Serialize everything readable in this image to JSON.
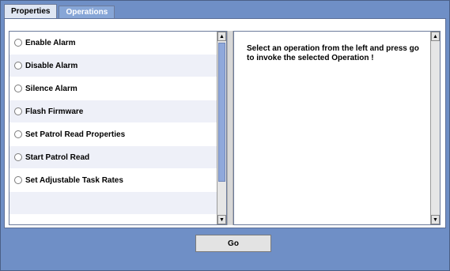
{
  "tabs": [
    {
      "label": "Properties",
      "active": true
    },
    {
      "label": "Operations",
      "active": false
    }
  ],
  "operations": [
    {
      "label": "Enable Alarm",
      "selected": false
    },
    {
      "label": "Disable Alarm",
      "selected": false
    },
    {
      "label": "Silence Alarm",
      "selected": false
    },
    {
      "label": "Flash Firmware",
      "selected": false
    },
    {
      "label": "Set Patrol Read Properties",
      "selected": false
    },
    {
      "label": "Start Patrol Read",
      "selected": false
    },
    {
      "label": "Set Adjustable Task Rates",
      "selected": false
    }
  ],
  "instructions": "Select an operation from the left and press go to invoke the selected Operation !",
  "go_button": "Go",
  "colors": {
    "frame": "#6f8fc6",
    "tab_active": "#dfe6f3",
    "tab_inactive": "#87a6d7",
    "scroll_thumb": "#8fa8db"
  }
}
